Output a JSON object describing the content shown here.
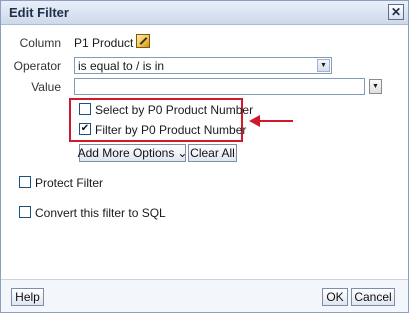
{
  "dialog": {
    "title": "Edit Filter",
    "close_glyph": "✕",
    "close_icon": "close-icon"
  },
  "form": {
    "column_label": "Column",
    "column_value": "P1  Product",
    "edit_icon": "edit-pencil-icon",
    "operator_label": "Operator",
    "operator_value": "is equal to / is in",
    "value_label": "Value",
    "value_input": "",
    "dropdown_glyph": "▼"
  },
  "options": {
    "select_by_label": "Select by P0  Product Number",
    "select_by_checked": false,
    "filter_by_label": "Filter by P0  Product Number",
    "filter_by_checked": true,
    "check_glyph": "✔",
    "highlight_color": "#d0192b"
  },
  "actions": {
    "add_more_label": "Add More Options",
    "add_more_glyph": "⌄",
    "clear_all_label": "Clear All"
  },
  "extra": {
    "protect_filter_label": "Protect Filter",
    "protect_filter_checked": false,
    "convert_sql_label": "Convert this filter to SQL",
    "convert_sql_checked": false
  },
  "footer": {
    "help_label": "Help",
    "ok_label": "OK",
    "cancel_label": "Cancel"
  }
}
